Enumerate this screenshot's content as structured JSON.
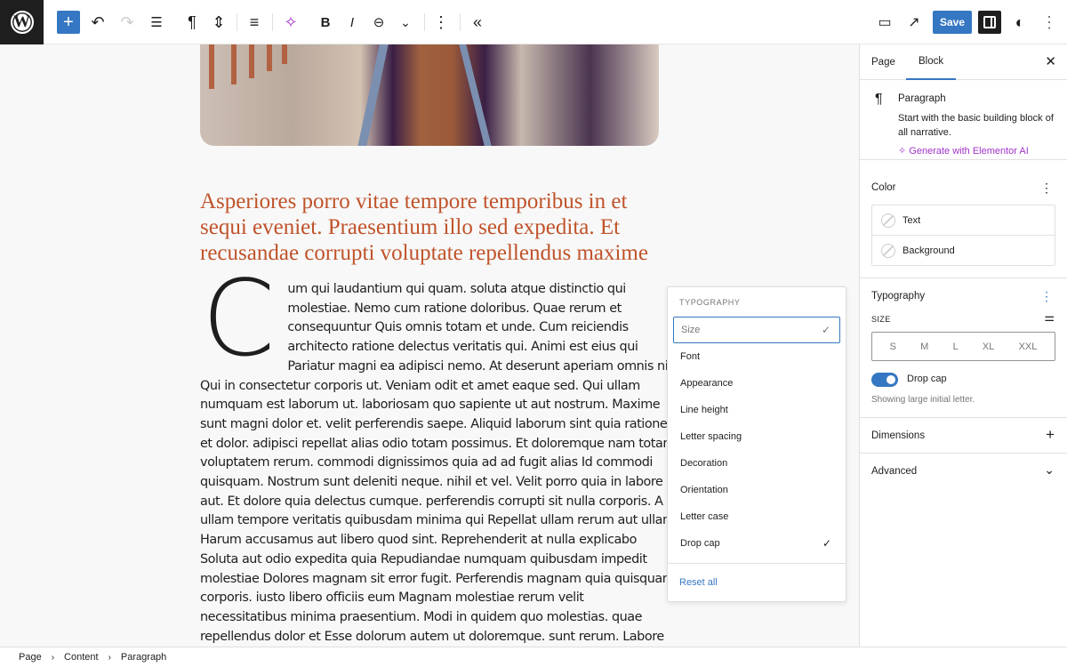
{
  "toolbar": {
    "add_block": "+",
    "undo": "↶",
    "redo": "↷",
    "list_view": "☰",
    "block_type": "¶",
    "move": "⇕",
    "align": "≡",
    "ai": "✧",
    "bold": "B",
    "italic": "I",
    "link": "⊖",
    "more_chevron": "⌄",
    "options": "⋮",
    "collapse": "«",
    "preview": "▭",
    "view_page": "↗",
    "save_label": "Save",
    "styles": "◐",
    "more": "⋮",
    "accent_color": "#3577c2",
    "ai_color": "#a033c7"
  },
  "content": {
    "heading": "Asperiores porro vitae tempore temporibus in et sequi eveniet. Praesentium illo sed expedita. Et recusandae corrupti voluptate repellendus maxime",
    "drop_cap": "C",
    "heading_color": "#c0532a",
    "lines": [
      "um qui laudantium qui quam. soluta atque distinctio qui",
      "molestiae. Nemo cum ratione doloribus. Quae rerum et",
      "consequuntur Quis omnis totam et unde. Cum reiciendis",
      "architecto ratione delectus veritatis qui. Animi est eius qui",
      "Pariatur magni ea adipisci nemo. At deserunt aperiam omnis nihil quisquam",
      "Qui in consectetur corporis ut. Veniam odit et amet eaque sed. Qui ullam",
      "numquam est laborum ut. laboriosam quo sapiente ut aut nostrum. Maxime",
      "sunt magni dolor et. velit perferendis saepe. Aliquid laborum sint quia ratione",
      "et dolor. adipisci repellat alias odio totam possimus. Et doloremque nam totam",
      "voluptatem rerum. commodi dignissimos quia ad ad fugit alias Id commodi",
      "quisquam. Nostrum sunt deleniti neque. nihil et vel. Velit porro quia in labore",
      "aut. Et dolore quia delectus cumque. perferendis corrupti sit nulla corporis. A",
      "ullam tempore veritatis quibusdam minima qui Repellat ullam rerum aut ullam.",
      "Harum accusamus aut libero quod sint. Reprehenderit at nulla explicabo",
      "Soluta aut odio expedita quia Repudiandae numquam quibusdam impedit",
      "molestiae Dolores magnam sit error fugit. Perferendis magnam quia quisquam",
      "corporis. iusto libero officiis eum Magnam molestiae rerum velit",
      "necessitatibus minima praesentium. Modi in quidem quo molestias. quae",
      "repellendus dolor et Esse dolorum autem ut doloremque. sunt rerum. Labore"
    ]
  },
  "popover": {
    "title": "TYPOGRAPHY",
    "items": [
      {
        "label": "Size",
        "checked": true
      },
      {
        "label": "Font",
        "checked": false
      },
      {
        "label": "Appearance",
        "checked": false
      },
      {
        "label": "Line height",
        "checked": false
      },
      {
        "label": "Letter spacing",
        "checked": false
      },
      {
        "label": "Decoration",
        "checked": false
      },
      {
        "label": "Orientation",
        "checked": false
      },
      {
        "label": "Letter case",
        "checked": false
      },
      {
        "label": "Drop cap",
        "checked": true
      }
    ],
    "check": "✓",
    "reset_label": "Reset all"
  },
  "sidebar": {
    "tabs": [
      "Page",
      "Block"
    ],
    "active_tab": "Block",
    "close": "✕",
    "block": {
      "icon": "¶",
      "name": "Paragraph",
      "description": "Start with the basic building block of all narrative.",
      "ai_link": "Generate with Elementor AI",
      "ai_icon": "✧"
    },
    "color": {
      "title": "Color",
      "items": [
        "Text",
        "Background"
      ]
    },
    "typography": {
      "title": "Typography",
      "size_label": "SIZE",
      "sizes": [
        "S",
        "M",
        "L",
        "XL",
        "XXL"
      ],
      "drop_cap_label": "Drop cap",
      "drop_cap_enabled": true,
      "drop_cap_help": "Showing large initial letter."
    },
    "dimensions": {
      "title": "Dimensions",
      "icon": "+"
    },
    "advanced": {
      "title": "Advanced",
      "icon": "⌄"
    },
    "kebab": "⋮"
  },
  "breadcrumb": {
    "items": [
      "Page",
      "Content",
      "Paragraph"
    ],
    "separator": "›"
  }
}
